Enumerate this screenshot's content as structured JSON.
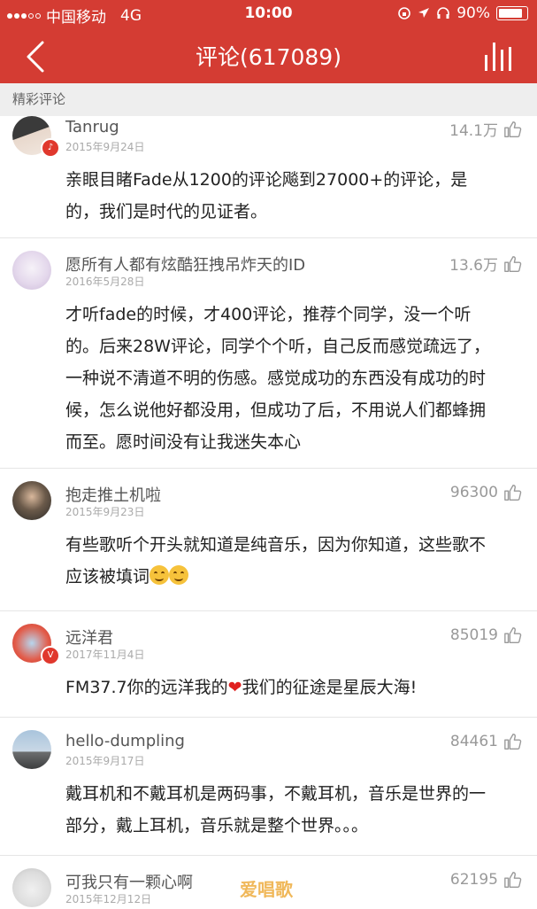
{
  "status_bar": {
    "carrier": "中国移动",
    "network": "4G",
    "time": "10:00",
    "battery": "90%"
  },
  "nav": {
    "title": "评论(617089)",
    "back_icon": "chevron-left-icon",
    "menu_icon": "bar-graph-icon"
  },
  "section": {
    "title": "精彩评论"
  },
  "comments": [
    {
      "user": "Tanrug",
      "date": "2015年9月24日",
      "likes": "14.1万",
      "text_lines": [
        "亲眼目睹Fade从1200的评论飚到27000+的评论，是",
        "的，我们是时代的见证者。"
      ]
    },
    {
      "user": "愿所有人都有炫酷狂拽吊炸天的ID",
      "date": "2016年5月28日",
      "likes": "13.6万",
      "text_lines": [
        "才听fade的时候，才400评论，推荐个同学，没一个听",
        "的。后来28W评论，同学个个听，自己反而感觉疏远了，",
        "一种说不清道不明的伤感。感觉成功的东西没有成功的时",
        "候，怎么说他好都没用，但成功了后，不用说人们都蜂拥",
        "而至。愿时间没有让我迷失本心"
      ]
    },
    {
      "user": "抱走推土机啦",
      "date": "2015年9月23日",
      "likes": "96300",
      "text_lines": [
        "有些歌听个开头就知道是纯音乐，因为你知道，这些歌不",
        "应该被填词"
      ]
    },
    {
      "user": "远洋君",
      "date": "2017年11月4日",
      "likes": "85019",
      "text_lines": [
        "FM37.7你的远洋我的",
        "我们的征途是星辰大海!"
      ]
    },
    {
      "user": "hello-dumpling",
      "date": "2015年9月17日",
      "likes": "84461",
      "text_lines": [
        "戴耳机和不戴耳机是两码事，不戴耳机，音乐是世界的一",
        "部分，戴上耳机，音乐就是整个世界。。。"
      ]
    },
    {
      "user": "可我只有一颗心啊",
      "date": "2015年12月12日",
      "likes": "62195",
      "text_lines": []
    }
  ],
  "watermark": "爱唱歌",
  "colors": {
    "accent": "#d43c33",
    "like_gray": "#999999"
  }
}
